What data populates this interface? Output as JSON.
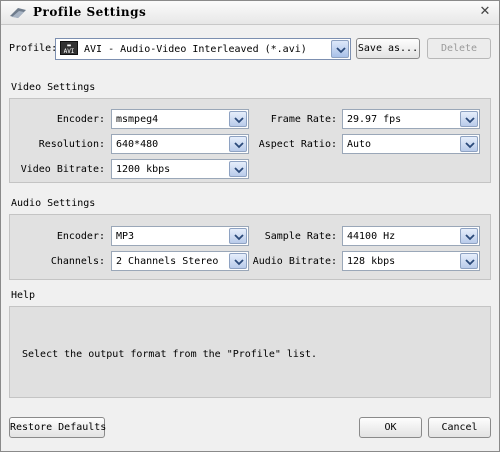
{
  "window": {
    "title": "Profile Settings",
    "close_glyph": "✕"
  },
  "profile": {
    "label": "Profile:",
    "icon_text": "AVI",
    "value": "AVI - Audio-Video Interleaved (*.avi)",
    "save_as_label": "Save as...",
    "delete_label": "Delete"
  },
  "video": {
    "title": "Video Settings",
    "encoder": {
      "label": "Encoder:",
      "value": "msmpeg4"
    },
    "resolution": {
      "label": "Resolution:",
      "value": "640*480"
    },
    "bitrate": {
      "label": "Video Bitrate:",
      "value": "1200 kbps"
    },
    "frame_rate": {
      "label": "Frame Rate:",
      "value": "29.97 fps"
    },
    "aspect_ratio": {
      "label": "Aspect Ratio:",
      "value": "Auto"
    }
  },
  "audio": {
    "title": "Audio Settings",
    "encoder": {
      "label": "Encoder:",
      "value": "MP3"
    },
    "channels": {
      "label": "Channels:",
      "value": "2 Channels Stereo"
    },
    "sample_rate": {
      "label": "Sample Rate:",
      "value": "44100 Hz"
    },
    "bitrate": {
      "label": "Audio Bitrate:",
      "value": "128 kbps"
    }
  },
  "help": {
    "title": "Help",
    "text": "Select the output format from the \"Profile\" list."
  },
  "footer": {
    "restore_label": "Restore Defaults",
    "ok_label": "OK",
    "cancel_label": "Cancel"
  },
  "icons": {
    "app": "logo-icon",
    "close": "close-icon",
    "dropdown": "chevron-down-icon",
    "profile_format": "avi-file-icon"
  }
}
